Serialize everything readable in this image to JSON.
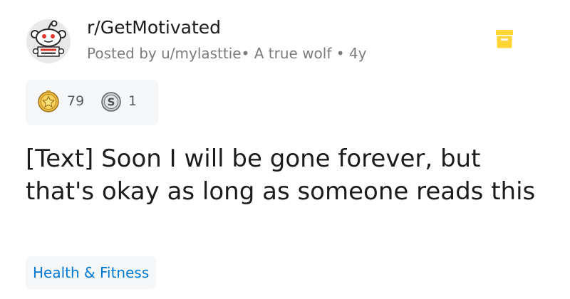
{
  "post": {
    "subreddit": "r/GetMotivated",
    "meta": "Posted by u/mylasttie• A true wolf • 4y",
    "title": "[Text] Soon I will be gone forever, but that's okay as long as someone reads this",
    "flair": "Health & Fitness"
  },
  "awards": [
    {
      "icon": "gold-star-award-icon",
      "count": "79"
    },
    {
      "icon": "silver-coin-award-icon",
      "count": "1"
    }
  ],
  "colors": {
    "accent_blue": "#0079d3",
    "muted_text": "#7c7c7c",
    "archive_yellow": "#ffd635",
    "award_bg": "#f6f7f8"
  }
}
